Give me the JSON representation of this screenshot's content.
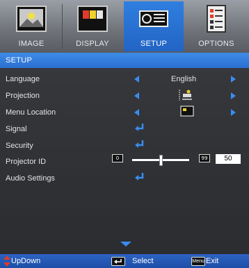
{
  "tabs": [
    {
      "label": "IMAGE",
      "icon": "image-icon",
      "active": false
    },
    {
      "label": "DISPLAY",
      "icon": "display-icon",
      "active": false
    },
    {
      "label": "SETUP",
      "icon": "projector-icon",
      "active": true
    },
    {
      "label": "OPTIONS",
      "icon": "options-icon",
      "active": false
    }
  ],
  "section_title": "SETUP",
  "rows": {
    "language": {
      "label": "Language",
      "value": "English"
    },
    "projection": {
      "label": "Projection",
      "value_icon": "projection-mode-icon"
    },
    "menu_location": {
      "label": "Menu Location",
      "value_icon": "menu-location-icon"
    },
    "signal": {
      "label": "Signal"
    },
    "security": {
      "label": "Security"
    },
    "projector_id": {
      "label": "Projector ID",
      "min": "0",
      "max": "99",
      "value": "50",
      "fraction": 0.5
    },
    "audio_settings": {
      "label": "Audio Settings"
    }
  },
  "footer": {
    "updown": "UpDown",
    "select": "Select",
    "menu_key": "Menu",
    "exit": "Exit"
  },
  "colors": {
    "accent": "#2a6fd0",
    "arrow": "#3a8cf0"
  }
}
